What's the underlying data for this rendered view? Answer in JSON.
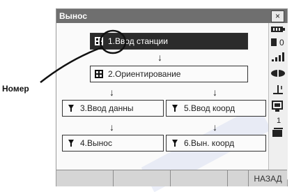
{
  "window": {
    "title": "Вынос",
    "close_glyph": "×"
  },
  "callout": {
    "label": "Номер"
  },
  "buttons": {
    "b1": {
      "label": "1.Ввод станции"
    },
    "b2": {
      "label": "2.Ориентирование"
    },
    "b3": {
      "label": "3.Ввод данны"
    },
    "b5": {
      "label": "5.Ввод коорд"
    },
    "b4": {
      "label": "4.Вынос"
    },
    "b6": {
      "label": "6.Вын. коорд"
    }
  },
  "sidebar": {
    "value_0": "0",
    "value_1": "1"
  },
  "bottom": {
    "keys": [
      "",
      "",
      "",
      "",
      "НАЗАД"
    ]
  },
  "icons": {
    "selected": "station-icon",
    "grid": "grid-icon",
    "prism": "prism-icon"
  }
}
